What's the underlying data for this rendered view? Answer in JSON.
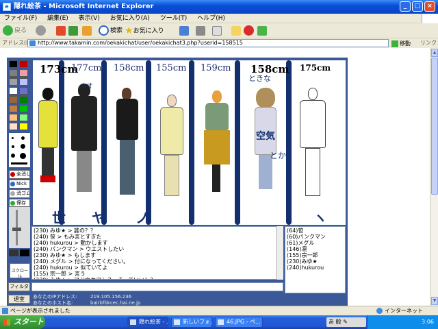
{
  "window": {
    "title": "隠れ絵茶 - Microsoft Internet Explorer"
  },
  "menu": [
    "ファイル(F)",
    "編集(E)",
    "表示(V)",
    "お気に入り(A)",
    "ツール(T)",
    "ヘルプ(H)"
  ],
  "toolbar": {
    "back": "戻る",
    "search": "検索",
    "favorites": "お気に入り"
  },
  "address": {
    "label": "アドレス(D)",
    "url": "http://www.takamin.com/oekakichat/user/oekakichat3.php?userid=158515",
    "go": "移動",
    "links": "リンク"
  },
  "palette_colors": [
    "#000000",
    "#c00000",
    "#7f7f7f",
    "#e8a0a0",
    "#a0a0a0",
    "#c0c0ff",
    "#ffffff",
    "#7070c0",
    "#996633",
    "#007f00",
    "#c08040",
    "#00c000",
    "#ffc080",
    "#80ff80",
    "#ffe0c0",
    "#ffff00"
  ],
  "tool_labels": {
    "clear": "全消し",
    "nick": "Nick",
    "eraser": "消ゴム",
    "save": "保存"
  },
  "canvas": {
    "heights": [
      "173cm",
      "177cm",
      "158cm",
      "155cm",
      "159cm",
      "158cm",
      "175cm"
    ],
    "bottom_names": [
      "世",
      "ノ",
      "ヤ",
      "",
      "ヽ"
    ],
    "annotations": [
      "カオ",
      "ときな",
      "空気",
      "とか"
    ]
  },
  "chat": [
    "(230) みゆ★ > 誰の？？",
    "(240) 笹 > もみ言とすぎた",
    "(240) hukurou > 動かします",
    "(240) パンクマン > ウエストしたい",
    "(230) みゆ★ > もします",
    "(240) メグル > 付になってください。",
    "(240) hukurou > 似ていてよ",
    "(155) 宗一郎 > 言う",
    "(230) みゆ★ > マジウケマシス。まっていい！？",
    "(240) 笹 > パスト100超え！"
  ],
  "users": [
    "(64)笹",
    "(60)パンクマン",
    "(61)メグル",
    "(146)凛",
    "(155)宗一郎",
    "(230)みゆ★",
    "(240)hukurou"
  ],
  "chat_buttons": {
    "scroll": "スクロール",
    "filter": "フィルタ",
    "exit": "退室"
  },
  "footer_info": {
    "ip_label": "あなたのIPアドレス:",
    "ip_value": "219.105.156.236",
    "host_label": "あなたのホスト名:",
    "host_value": "bairbfbkcec.hai.ne.jp"
  },
  "status": {
    "text": "ページが表示されました",
    "zone": "インターネット"
  },
  "taskbar": {
    "start": "スタート",
    "tasks": [
      "隠れ絵茶 - ...",
      "新しいフォルダ",
      "46.JPG - ペ..."
    ],
    "ime": "あ 般 ✎",
    "clock": "3:06"
  }
}
